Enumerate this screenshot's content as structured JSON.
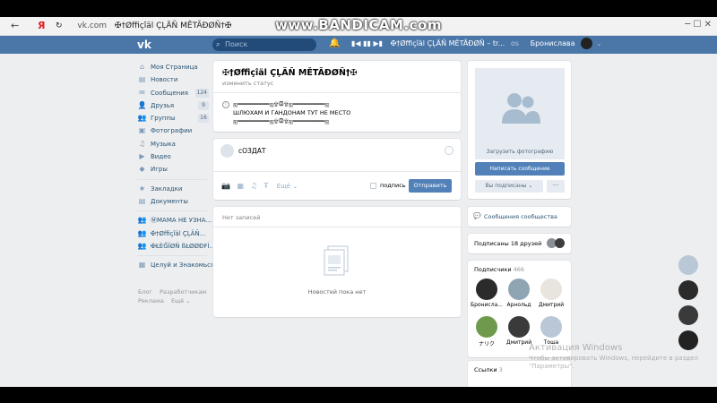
{
  "watermark": "www.BANDICAM.com",
  "browser": {
    "back": "←",
    "yandex": "Я",
    "refresh": "↻",
    "host": "vk.com",
    "tab_title": "✠†Øffiçîäl ÇĻÄÑ MĚTÃĐØÑ†✠",
    "window_controls": "─ ☐ ✕"
  },
  "header": {
    "logo": "vk",
    "search_placeholder": "Поиск",
    "search_icon": "magnifier-icon",
    "player_controls": "▮◀ ▮▮ ▶▮",
    "track": "✠†Øffiçîäl ÇĻÄÑ MĚTÃĐØÑ – tr...",
    "pre_user": "os",
    "user_name": "Бронислава"
  },
  "menu": [
    {
      "icon": "⌂",
      "label": "Моя Страница"
    },
    {
      "icon": "▤",
      "label": "Новости"
    },
    {
      "icon": "✉",
      "label": "Сообщения",
      "badge": "124"
    },
    {
      "icon": "👤",
      "label": "Друзья",
      "badge": "9"
    },
    {
      "icon": "👥",
      "label": "Группы",
      "badge": "16"
    },
    {
      "icon": "▣",
      "label": "Фотографии"
    },
    {
      "icon": "♫",
      "label": "Музыка"
    },
    {
      "icon": "▶",
      "label": "Видео"
    },
    {
      "icon": "◆",
      "label": "Игры"
    }
  ],
  "menu2": [
    {
      "icon": "★",
      "label": "Закладки"
    },
    {
      "icon": "▤",
      "label": "Документы"
    }
  ],
  "menu3": [
    {
      "icon": "👥",
      "label": "ⓂМАМА НЕ УЗНА..."
    },
    {
      "icon": "👥",
      "label": "✠†Øffiçîäl ÇĻÄÑ..."
    },
    {
      "icon": "👥",
      "label": "✠ŁÈĜÏØŇ ßŁØØĐFÌ..."
    }
  ],
  "menu4": [
    {
      "icon": "▦",
      "label": "Целуй и Знакомься"
    }
  ],
  "footer": {
    "line1": [
      "Блог",
      "Разработчикам"
    ],
    "line2": [
      "Реклама",
      "Ещё ⌄"
    ]
  },
  "profile": {
    "name": "✠†Øffiçîäl ÇĻÄÑ MĚTÃĐØÑ†✠",
    "status": "изменить статус",
    "info1": "ஐ═════════ஐ۩۞۩ஐ═════════ஐ",
    "info2": "ШЛЮХАМ И ГАНДОНАМ ТУТ НЕ МЕСТО",
    "info3": "ஐ═════════ஐ۩۞۩ஐ═════════ஐ"
  },
  "post": {
    "input_value": "сОЗДАТ",
    "tools": [
      "📷",
      "▦",
      "♫",
      "Ŧ"
    ],
    "more_label": "Ещё ⌄",
    "signature_label": "подпись",
    "send_label": "Отправить"
  },
  "wall": {
    "title": "Нет записей",
    "empty_text": "Новостей пока нет"
  },
  "right": {
    "upload_label": "Загрузить фотографию",
    "write_label": "Написать сообщение",
    "subscribed_label": "Вы подписаны ⌄",
    "more_dots": "···",
    "community_messages": "Сообщения сообщества",
    "friends_subscribed": "Подписаны 18 друзей",
    "subscribers_title": "Подписчики",
    "subscribers_count": "466",
    "subscribers": [
      {
        "name": "Бронисла...",
        "color": "#2b2b2b"
      },
      {
        "name": "Арнольд",
        "color": "#8fa5b4"
      },
      {
        "name": "Дмитрий",
        "color": "#e8e4de"
      },
      {
        "name": "ナリク",
        "color": "#6f9a4c"
      },
      {
        "name": "Дмитрий",
        "color": "#3a3a3a"
      },
      {
        "name": "Тоша",
        "color": "#b9c7d6"
      }
    ],
    "links_title": "Ссылки",
    "links_count": "3"
  },
  "windows_activation": {
    "title": "Активация Windows",
    "line1": "Чтобы активировать Windows, перейдите в раздел",
    "line2": "\"Параметры\"."
  },
  "colors": {
    "vk_blue": "#4a76a8",
    "button_blue": "#5181b8",
    "page_bg": "#edeef0"
  }
}
